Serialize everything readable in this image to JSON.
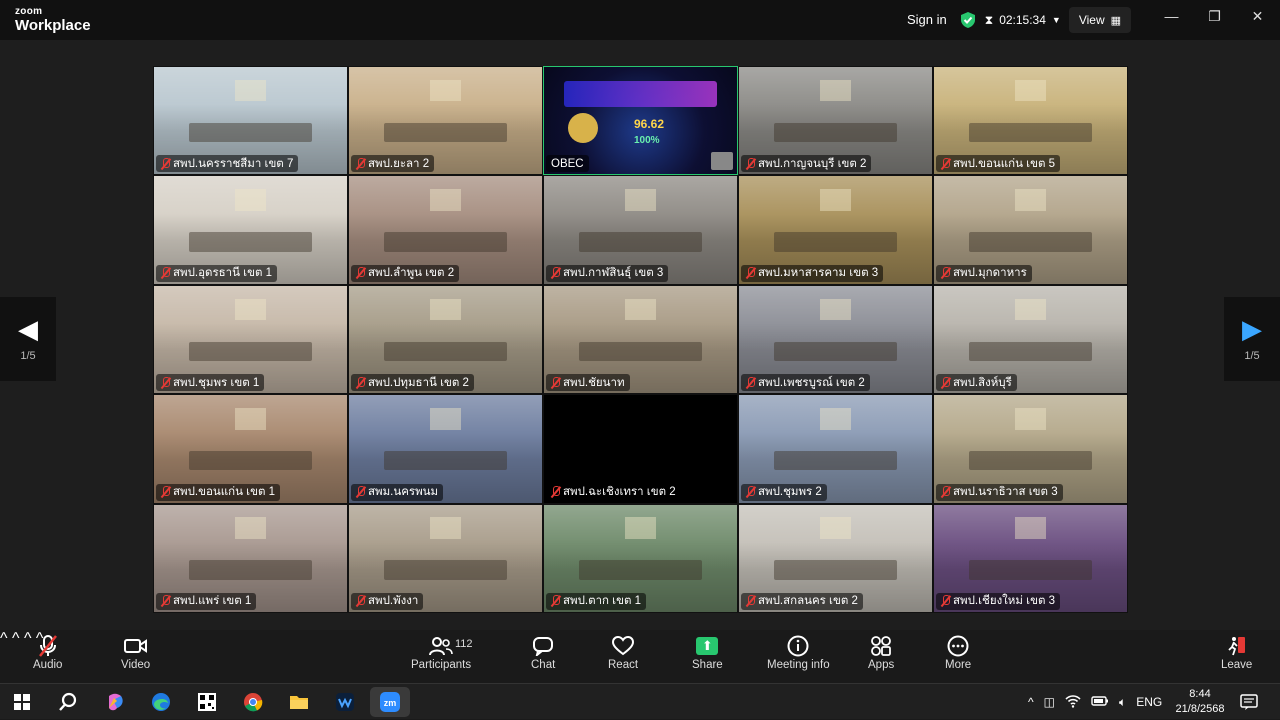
{
  "app": {
    "brand_top": "zoom",
    "brand_bottom": "Workplace",
    "sign_in": "Sign in",
    "timer": "02:15:34",
    "view_label": "View"
  },
  "pager": {
    "left_page": "1/5",
    "right_page": "1/5"
  },
  "tiles": [
    {
      "label": "สพป.นครราชสีมา เขต 7",
      "muted": true,
      "bg": "#b9c7cf"
    },
    {
      "label": "สพป.ยะลา 2",
      "muted": true,
      "bg": "#c9b08a"
    },
    {
      "label": "OBEC",
      "muted": false,
      "bg": "#14143a",
      "active": true
    },
    {
      "label": "สพป.กาญจนบุรี เขต 2",
      "muted": true,
      "bg": "#8b8a86"
    },
    {
      "label": "สพป.ขอนแก่น เขต 5",
      "muted": true,
      "bg": "#c8b27a"
    },
    {
      "label": "สพป.อุดรธานี เขต 1",
      "muted": true,
      "bg": "#d6d0c6"
    },
    {
      "label": "สพป.ลำพูน เขต 2",
      "muted": true,
      "bg": "#a68e80"
    },
    {
      "label": "สพป.กาฬสินธุ์ เขต 3",
      "muted": true,
      "bg": "#8e8a84"
    },
    {
      "label": "สพป.มหาสารคาม เขต 3",
      "muted": true,
      "bg": "#a8905a"
    },
    {
      "label": "สพป.มุกดาหาร",
      "muted": true,
      "bg": "#b2a48a"
    },
    {
      "label": "สพป.ชุมพร เขต 1",
      "muted": true,
      "bg": "#c6b8a8"
    },
    {
      "label": "สพป.ปทุมธานี เขต 2",
      "muted": true,
      "bg": "#a69c88"
    },
    {
      "label": "สพป.ชัยนาท",
      "muted": true,
      "bg": "#a89a84"
    },
    {
      "label": "สพป.เพชรบูรณ์ เขต 2",
      "muted": true,
      "bg": "#8c8e96"
    },
    {
      "label": "สพป.สิงห์บุรี",
      "muted": true,
      "bg": "#b8b4ac"
    },
    {
      "label": "สพป.ขอนแก่น เขต 1",
      "muted": true,
      "bg": "#a8886e"
    },
    {
      "label": "สพม.นครพนม",
      "muted": true,
      "bg": "#6e7ea0"
    },
    {
      "label": "สพป.ฉะเชิงเทรา เขต 2",
      "muted": true,
      "bg": "#000000"
    },
    {
      "label": "สพป.ชุมพร 2",
      "muted": true,
      "bg": "#8a9ab4"
    },
    {
      "label": "สพป.นราธิวาส เขต 3",
      "muted": true,
      "bg": "#b4a88a"
    },
    {
      "label": "สพป.แพร่ เขต 1",
      "muted": true,
      "bg": "#a89890"
    },
    {
      "label": "สพป.พังงา",
      "muted": true,
      "bg": "#a89c8a"
    },
    {
      "label": "สพป.ตาก เขต 1",
      "muted": true,
      "bg": "#6e8a6a"
    },
    {
      "label": "สพป.สกลนคร เขต 2",
      "muted": true,
      "bg": "#c4c0b8"
    },
    {
      "label": "สพป.เชียงใหม่ เขต 3",
      "muted": true,
      "bg": "#6a4e80"
    }
  ],
  "obec_slide": {
    "score": "96.62",
    "percent": "100%"
  },
  "toolbar": {
    "audio": "Audio",
    "video": "Video",
    "participants": "Participants",
    "participant_count": "112",
    "chat": "Chat",
    "react": "React",
    "share": "Share",
    "meeting_info": "Meeting info",
    "apps": "Apps",
    "more": "More",
    "leave": "Leave"
  },
  "taskbar": {
    "lang": "ENG",
    "time": "8:44",
    "date": "21/8/2568"
  },
  "colors": {
    "accent_green": "#28c76f",
    "mute_red": "#e53935",
    "leave_red": "#e53935"
  }
}
